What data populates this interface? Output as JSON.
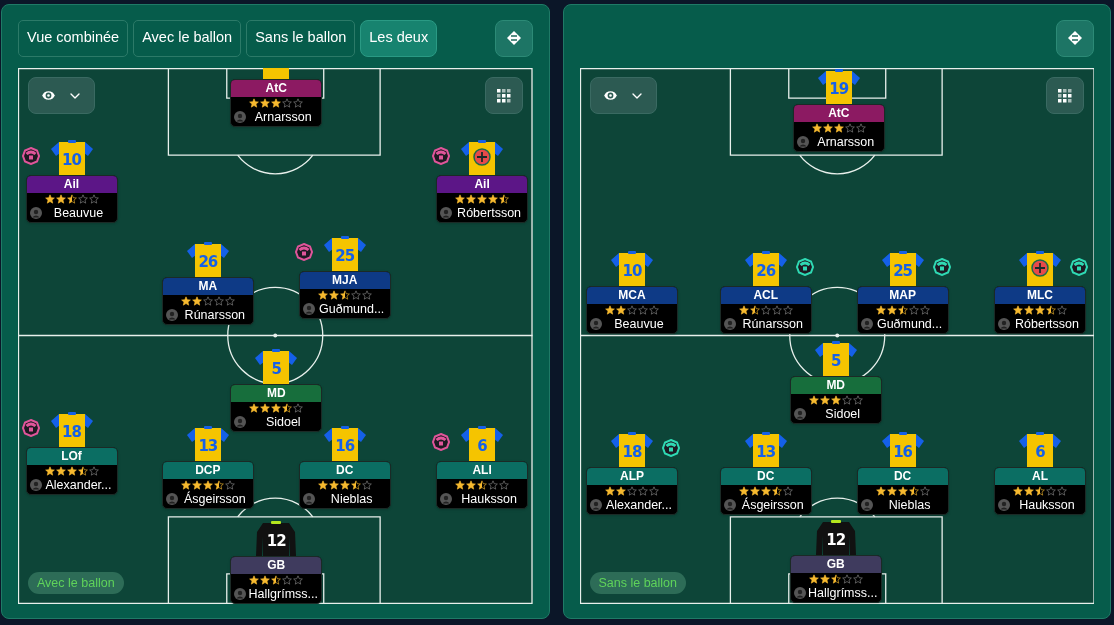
{
  "panels": [
    {
      "tabs": [
        {
          "label": "Vue combinée",
          "selected": false
        },
        {
          "label": "Avec le ballon",
          "selected": false
        },
        {
          "label": "Sans le ballon",
          "selected": false
        },
        {
          "label": "Les deux",
          "selected": true
        }
      ],
      "mode_label": "Avec le ballon",
      "players": [
        {
          "role": "AtC",
          "color": "#8c1a62",
          "name": "Arnarsson",
          "stars": 3,
          "kind": "outfield",
          "injured": false
        },
        {
          "role": "Ail",
          "color": "#5c1687",
          "name": "Beauvue",
          "number": "10",
          "stars": 2.5,
          "kind": "outfield",
          "injured": false,
          "badge": {
            "color": "#e0559a"
          }
        },
        {
          "role": "Ail",
          "color": "#5c1687",
          "name": "Róbertsson",
          "stars": 4.5,
          "kind": "outfield",
          "injured": true,
          "badge": {
            "color": "#e0559a"
          }
        },
        {
          "role": "MA",
          "color": "#0e3a86",
          "name": "Rúnarsson",
          "number": "26",
          "stars": 2,
          "kind": "outfield",
          "injured": false
        },
        {
          "role": "MJA",
          "color": "#0e3a86",
          "name": "Guðmund...",
          "number": "25",
          "stars": 2.5,
          "kind": "outfield",
          "injured": false,
          "badge": {
            "color": "#e0559a"
          }
        },
        {
          "role": "MD",
          "color": "#176e3c",
          "name": "Sidoel",
          "number": "5",
          "stars": 3.5,
          "kind": "outfield",
          "injured": false
        },
        {
          "role": "LOf",
          "color": "#0b6e63",
          "name": "Alexander...",
          "number": "18",
          "stars": 3.5,
          "kind": "outfield",
          "injured": false,
          "badge": {
            "color": "#e0559a"
          }
        },
        {
          "role": "DCP",
          "color": "#0b6e63",
          "name": "Ásgeirsson",
          "number": "13",
          "stars": 3.5,
          "kind": "outfield",
          "injured": false
        },
        {
          "role": "DC",
          "color": "#0b6e63",
          "name": "Nieblas",
          "number": "16",
          "stars": 3.5,
          "kind": "outfield",
          "injured": false
        },
        {
          "role": "ALI",
          "color": "#0b6e63",
          "name": "Hauksson",
          "number": "6",
          "stars": 2.5,
          "kind": "outfield",
          "injured": false,
          "badge": {
            "color": "#e0559a"
          }
        },
        {
          "role": "GB",
          "color": "#3f3b5e",
          "name": "Hallgrímss...",
          "number": "12",
          "stars": 2.5,
          "kind": "goalkeeper",
          "injured": false
        }
      ]
    },
    {
      "mode_label": "Sans le ballon",
      "players": [
        {
          "role": "AtC",
          "color": "#8c1a62",
          "name": "Arnarsson",
          "number": "19",
          "stars": 3,
          "kind": "outfield",
          "injured": false
        },
        {
          "role": "MCA",
          "color": "#0e3a86",
          "name": "Beauvue",
          "number": "10",
          "stars": 2,
          "kind": "outfield",
          "injured": false
        },
        {
          "role": "ACL",
          "color": "#0e3a86",
          "name": "Rúnarsson",
          "number": "26",
          "stars": 1.5,
          "kind": "outfield",
          "injured": false,
          "badge": {
            "color": "#2fd9b3"
          }
        },
        {
          "role": "MAP",
          "color": "#0e3a86",
          "name": "Guðmund...",
          "number": "25",
          "stars": 2.5,
          "kind": "outfield",
          "injured": false,
          "badge": {
            "color": "#2fd9b3"
          }
        },
        {
          "role": "MLC",
          "color": "#0e3a86",
          "name": "Róbertsson",
          "stars": 3.5,
          "kind": "outfield",
          "injured": true,
          "badge": {
            "color": "#2fd9b3"
          }
        },
        {
          "role": "MD",
          "color": "#176e3c",
          "name": "Sidoel",
          "number": "5",
          "stars": 3,
          "kind": "outfield",
          "injured": false
        },
        {
          "role": "ALP",
          "color": "#0b6e63",
          "name": "Alexander...",
          "number": "18",
          "stars": 2,
          "kind": "outfield",
          "injured": false,
          "badge": {
            "color": "#2fd9b3"
          }
        },
        {
          "role": "DC",
          "color": "#0b6e63",
          "name": "Ásgeirsson",
          "number": "13",
          "stars": 3.5,
          "kind": "outfield",
          "injured": false
        },
        {
          "role": "DC",
          "color": "#0b6e63",
          "name": "Nieblas",
          "number": "16",
          "stars": 3.5,
          "kind": "outfield",
          "injured": false
        },
        {
          "role": "AL",
          "color": "#0b6e63",
          "name": "Hauksson",
          "number": "6",
          "stars": 2.5,
          "kind": "outfield",
          "injured": false
        },
        {
          "role": "GB",
          "color": "#3f3b5e",
          "name": "Hallgrímss...",
          "number": "12",
          "stars": 2.5,
          "kind": "goalkeeper",
          "injured": false
        }
      ]
    }
  ]
}
